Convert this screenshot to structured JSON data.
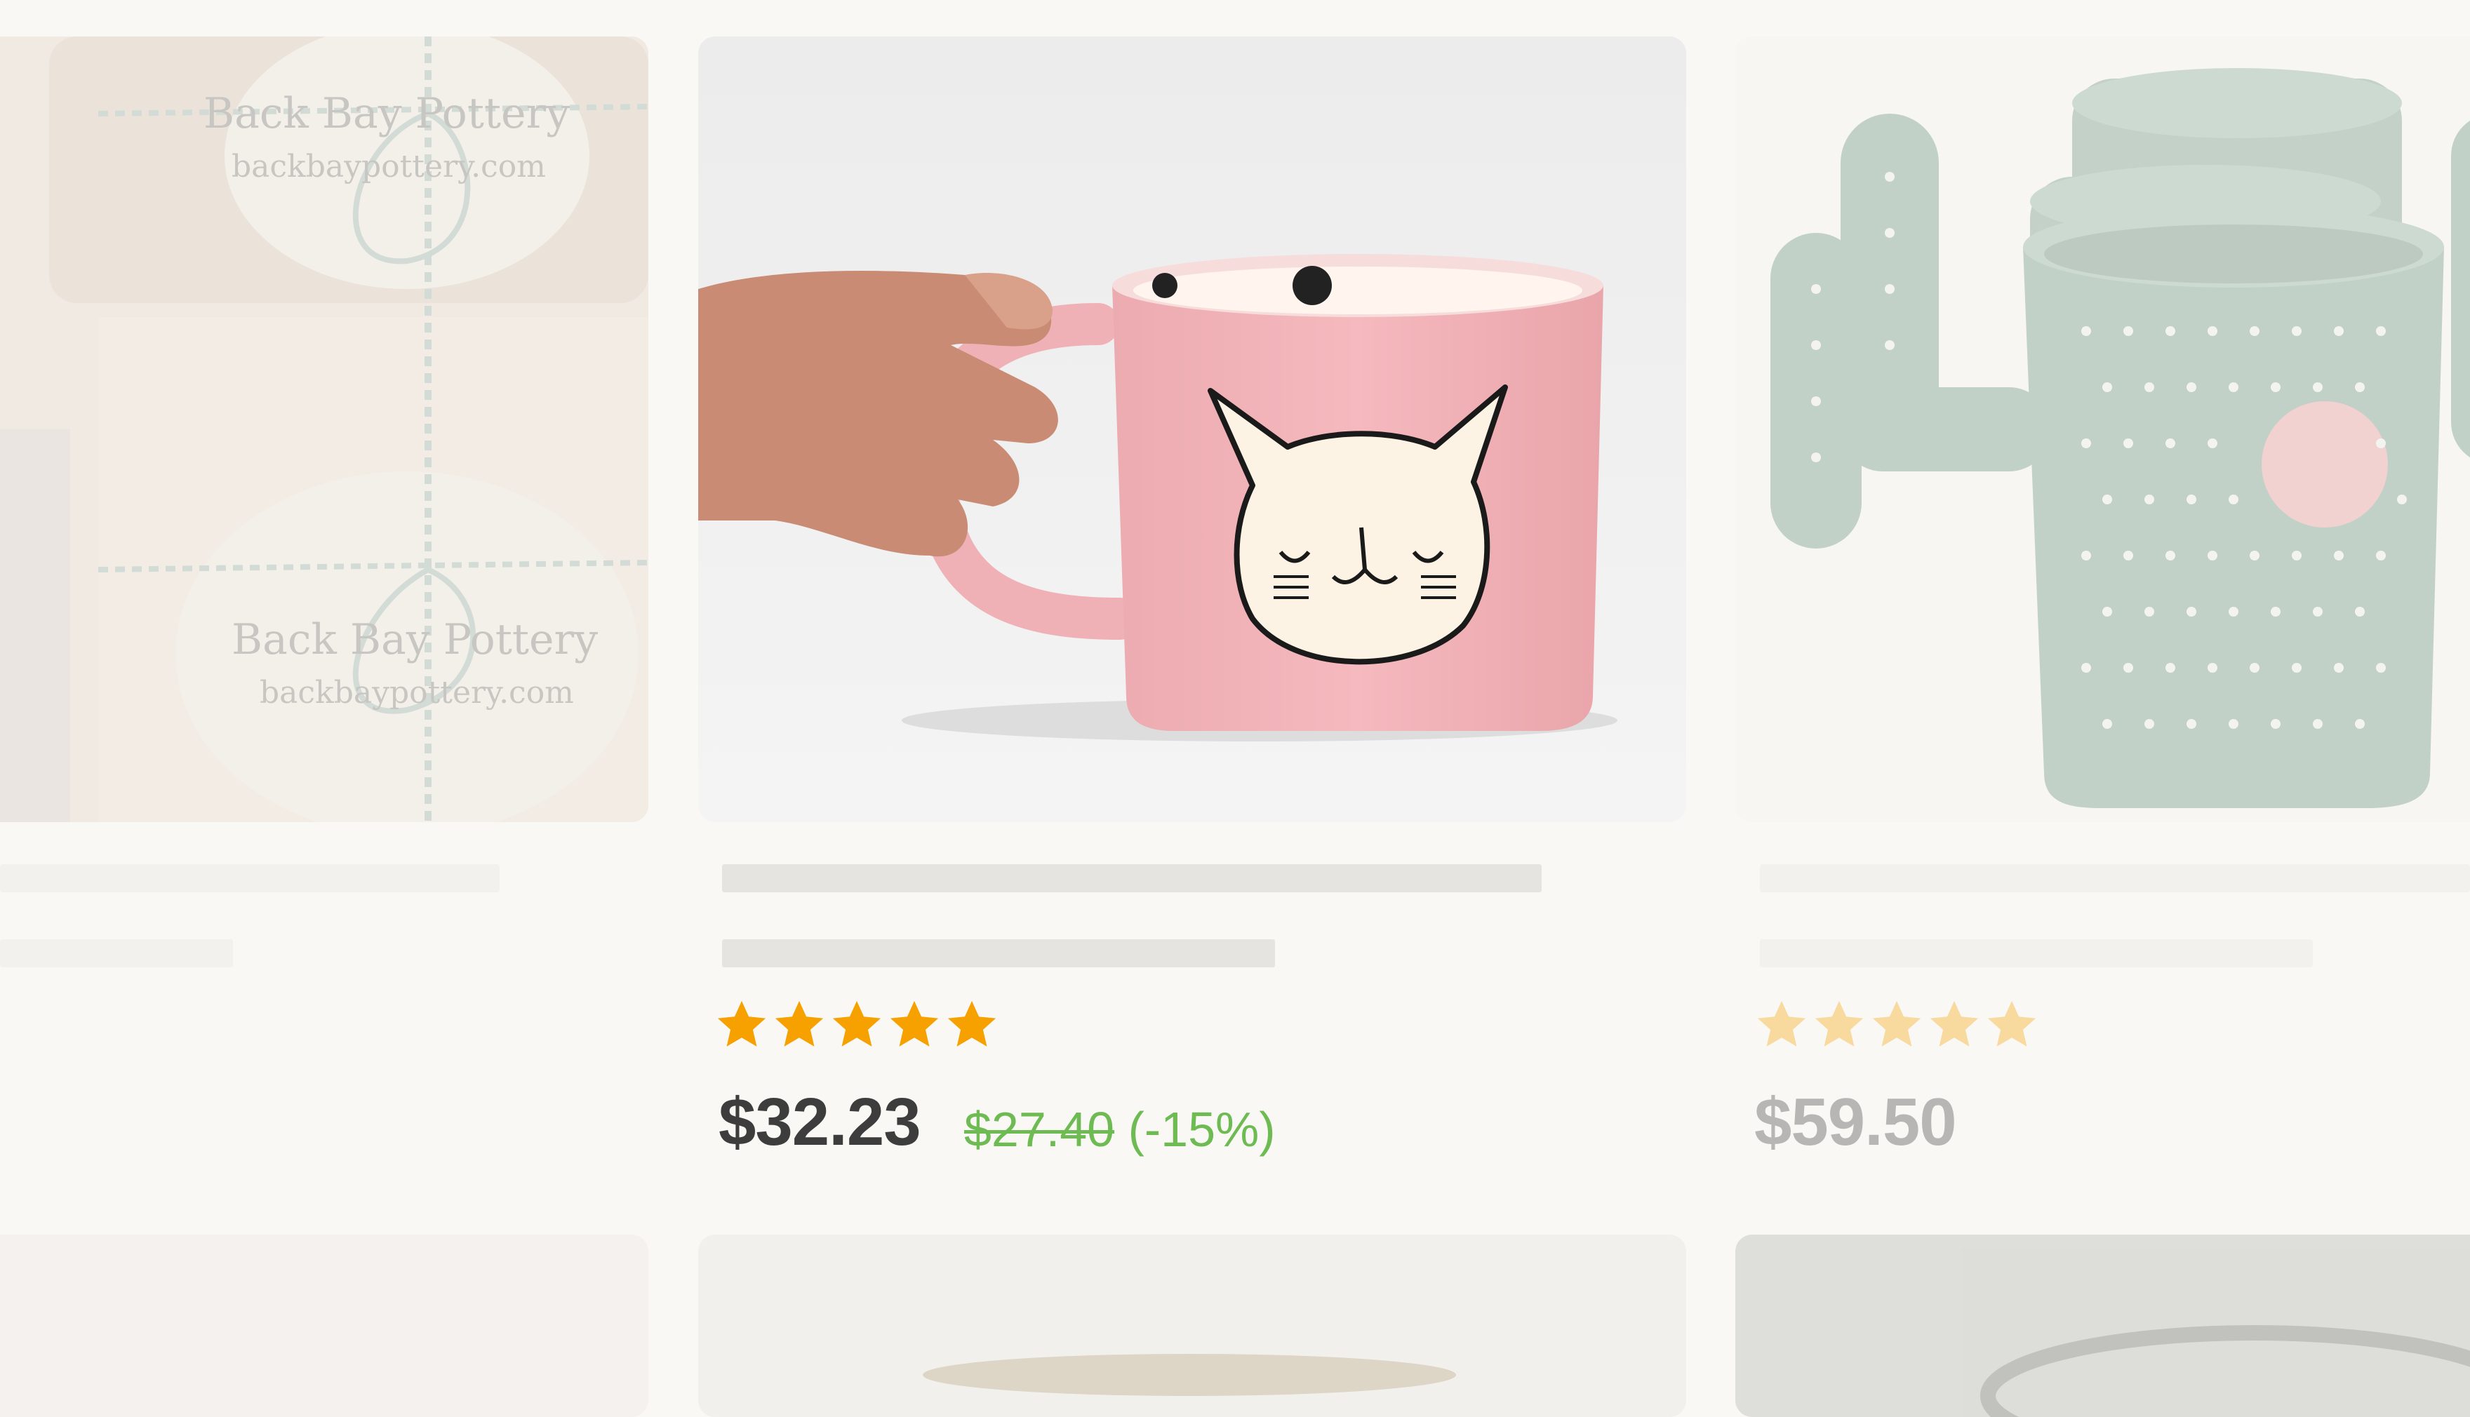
{
  "colors": {
    "background": "#faf8f5",
    "skeleton": "#e6e4e1",
    "star": "#f6a100",
    "discount": "#6dbb52",
    "price": "#3d3d3d"
  },
  "listings": [
    {
      "name": "listing-left",
      "image_text": {
        "brand_top": "Back Bay Pottery",
        "url_top": "backbaypottery.com",
        "brand_bottom": "Back Bay Pottery",
        "url_bottom": "backbaypottery.com"
      }
    },
    {
      "name": "listing-cat-mug",
      "rating_stars": 5,
      "price": "$32.23",
      "original_price": "$27.40",
      "discount": "(-15%)"
    },
    {
      "name": "listing-cactus-mug",
      "rating_stars": 5,
      "price": "$59.50"
    }
  ],
  "icons": {
    "star": "star-icon"
  }
}
